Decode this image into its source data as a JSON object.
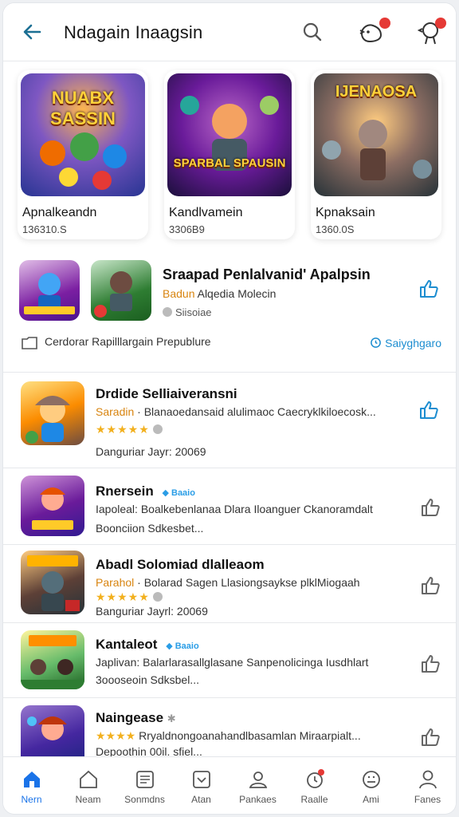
{
  "header": {
    "title": "Ndagain Inaagsin",
    "back_icon": "arrow-left-icon",
    "search_icon": "search-icon",
    "notif1_badge": "",
    "notif2_badge": ""
  },
  "featured": [
    {
      "name": "Apnalkeandn",
      "size": "136310.S",
      "art_text": "NUABX SASSIN"
    },
    {
      "name": "Kandlvamein",
      "size": "3306B9",
      "art_text": "SPARBAL SPAUSIN"
    },
    {
      "name": "Kpnaksain",
      "size": "1360.0S",
      "art_text": "IJENAOSA"
    }
  ],
  "bundle": {
    "title": "Sraapad Penlalvanid' Apalpsin",
    "sub_orange": "Badun",
    "sub_rest": "Alqedia Molecin",
    "stat": "Siisoiae",
    "footer": "Cerdorar Rapilllargain Prepublure",
    "link": "Saiyghgaro"
  },
  "items": [
    {
      "name": "Drdide Selliaiveransni",
      "desc_orange": "Saradin",
      "desc": "· Blanaoedansaid alulimaoc Caecryklkiloecosk...",
      "rating": "★★★★★",
      "stat": "Danguriar Jayr: 20069",
      "tag": ""
    },
    {
      "name": "Rnersein",
      "tag": "Baaio",
      "desc": "Iapoleal: Boalkebenlanaa Dlara Iloanguer Ckanoramdalt",
      "desc2": "Boonciion Sdkesbet...",
      "stat": "",
      "rating": ""
    },
    {
      "name": "Abadl Solomiad dlalleaom",
      "desc_orange": "Parahol",
      "desc": "· Bolarad Sagen Llasiongsaykse plklMiogaah",
      "rating": "★★★★★",
      "stat": "Banguriar Jayrl: 20069",
      "tag": ""
    },
    {
      "name": "Kantaleot",
      "tag": "Baaio",
      "desc": "Japlivan: Balarlarasallglasane Sanpenolicinga Iusdhlart",
      "desc2": "3oooseoin Sdksbel...",
      "stat": "",
      "rating": ""
    },
    {
      "name": "Naingease",
      "tag": "",
      "rating": "★★★★",
      "desc": "Rryaldnongoanahandlbasamlan Miraarpialt...",
      "desc2": "Depoothin 00il. sfiel...",
      "stat": ""
    }
  ],
  "nav": [
    {
      "label": "Nern",
      "icon": "home-icon"
    },
    {
      "label": "Neam",
      "icon": "house-outline-icon"
    },
    {
      "label": "Sonmdns",
      "icon": "list-icon"
    },
    {
      "label": "Atan",
      "icon": "download-box-icon"
    },
    {
      "label": "Pankaes",
      "icon": "person-stack-icon"
    },
    {
      "label": "Raalle",
      "icon": "clock-icon"
    },
    {
      "label": "Ami",
      "icon": "smile-icon"
    },
    {
      "label": "Fanes",
      "icon": "profile-icon"
    }
  ],
  "colors": {
    "accent": "#1a73e8",
    "link": "#1c8dd0",
    "star": "#f2b01e",
    "orange": "#d8840f",
    "badge": "#e53935"
  }
}
